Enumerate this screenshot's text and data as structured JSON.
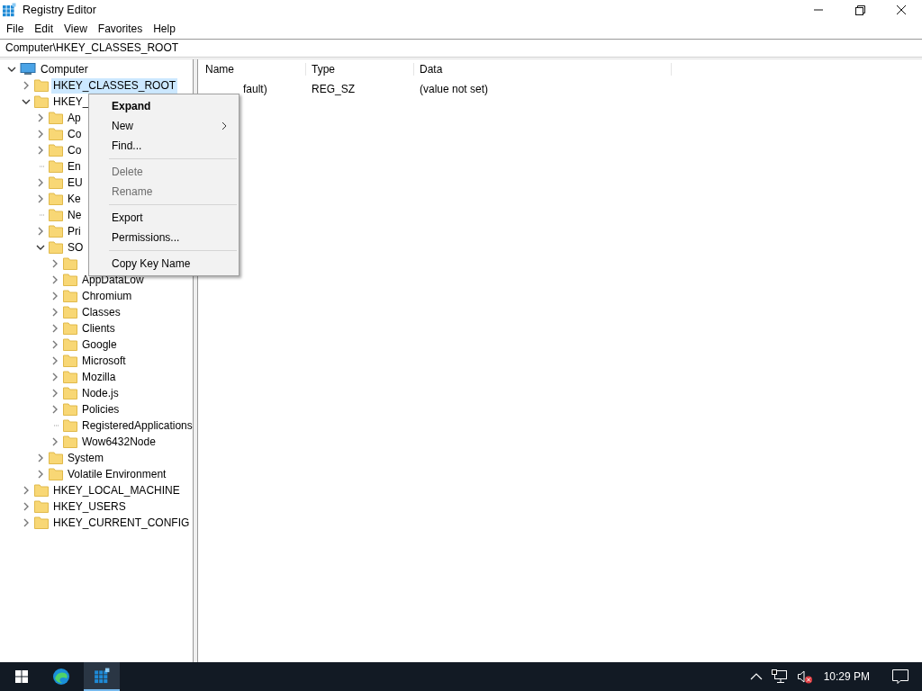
{
  "window": {
    "title": "Registry Editor"
  },
  "menu_bar": [
    "File",
    "Edit",
    "View",
    "Favorites",
    "Help"
  ],
  "address": "Computer\\HKEY_CLASSES_ROOT",
  "tree": [
    {
      "label": "Computer",
      "kind": "computer",
      "expanded": true,
      "has_subkeys": true,
      "selected": false,
      "children": [
        {
          "label": "HKEY_CLASSES_ROOT",
          "has_subkeys": true,
          "selected": true
        },
        {
          "label": "HKEY_",
          "expanded": true,
          "has_subkeys": true,
          "selected": false,
          "children": [
            {
              "label": "Ap",
              "has_subkeys": true,
              "selected": false
            },
            {
              "label": "Co",
              "has_subkeys": true,
              "selected": false
            },
            {
              "label": "Co",
              "has_subkeys": true,
              "selected": false
            },
            {
              "label": "En",
              "has_subkeys": false,
              "selected": false
            },
            {
              "label": "EU",
              "has_subkeys": true,
              "selected": false
            },
            {
              "label": "Ke",
              "has_subkeys": true,
              "selected": false
            },
            {
              "label": "Ne",
              "has_subkeys": false,
              "selected": false
            },
            {
              "label": "Pri",
              "has_subkeys": true,
              "selected": false
            },
            {
              "label": "SO",
              "expanded": true,
              "has_subkeys": true,
              "selected": false,
              "children": [
                {
                  "has_subkeys": true,
                  "selected": false
                },
                {
                  "label": "AppDataLow",
                  "has_subkeys": true,
                  "selected": false
                },
                {
                  "label": "Chromium",
                  "has_subkeys": true,
                  "selected": false
                },
                {
                  "label": "Classes",
                  "has_subkeys": true,
                  "selected": false
                },
                {
                  "label": "Clients",
                  "has_subkeys": true,
                  "selected": false
                },
                {
                  "label": "Google",
                  "has_subkeys": true,
                  "selected": false
                },
                {
                  "label": "Microsoft",
                  "has_subkeys": true,
                  "selected": false
                },
                {
                  "label": "Mozilla",
                  "has_subkeys": true,
                  "selected": false
                },
                {
                  "label": "Node.js",
                  "has_subkeys": true,
                  "selected": false
                },
                {
                  "label": "Policies",
                  "has_subkeys": true,
                  "selected": false
                },
                {
                  "label": "RegisteredApplications",
                  "has_subkeys": false,
                  "selected": false
                },
                {
                  "label": "Wow6432Node",
                  "has_subkeys": true,
                  "selected": false
                }
              ]
            },
            {
              "label": "System",
              "has_subkeys": true,
              "selected": false
            },
            {
              "label": "Volatile Environment",
              "has_subkeys": true,
              "selected": false
            }
          ]
        },
        {
          "label": "HKEY_LOCAL_MACHINE",
          "has_subkeys": true,
          "selected": false
        },
        {
          "label": "HKEY_USERS",
          "has_subkeys": true,
          "selected": false
        },
        {
          "label": "HKEY_CURRENT_CONFIG",
          "has_subkeys": true,
          "selected": false
        }
      ]
    }
  ],
  "table": {
    "columns": [
      "Name",
      "Type",
      "Data"
    ],
    "rows": [
      [
        "fault)",
        "REG_SZ",
        "(value not set)"
      ]
    ]
  },
  "context_menu": [
    {
      "kind": "item",
      "label": "Expand",
      "default": true,
      "disabled": false,
      "submenu": false
    },
    {
      "kind": "item",
      "label": "New",
      "default": false,
      "disabled": false,
      "submenu": true
    },
    {
      "kind": "item",
      "label": "Find...",
      "default": false,
      "disabled": false,
      "submenu": false
    },
    {
      "kind": "separator"
    },
    {
      "kind": "item",
      "label": "Delete",
      "default": false,
      "disabled": true,
      "submenu": false
    },
    {
      "kind": "item",
      "label": "Rename",
      "default": false,
      "disabled": true,
      "submenu": false
    },
    {
      "kind": "separator"
    },
    {
      "kind": "item",
      "label": "Export",
      "default": false,
      "disabled": false,
      "submenu": false
    },
    {
      "kind": "item",
      "label": "Permissions...",
      "default": false,
      "disabled": false,
      "submenu": false
    },
    {
      "kind": "separator"
    },
    {
      "kind": "item",
      "label": "Copy Key Name",
      "default": false,
      "disabled": false,
      "submenu": false
    }
  ],
  "taskbar": {
    "apps": [
      {
        "kind": "browser",
        "selected": false
      },
      {
        "kind": "regedit",
        "selected": true
      }
    ],
    "clock": "10:29 PM"
  }
}
